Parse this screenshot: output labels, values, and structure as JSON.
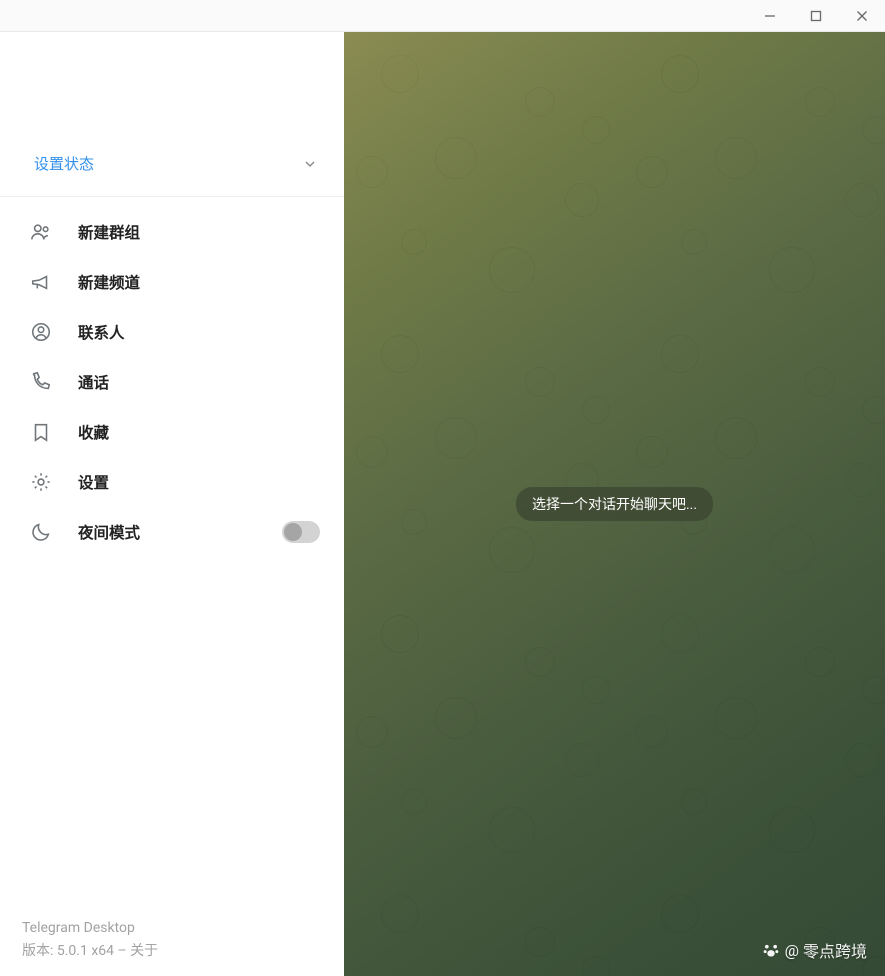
{
  "header": {
    "set_status": "设置状态"
  },
  "menu": {
    "new_group": "新建群组",
    "new_channel": "新建频道",
    "contacts": "联系人",
    "calls": "通话",
    "saved": "收藏",
    "settings": "设置",
    "night_mode": "夜间模式"
  },
  "chat": {
    "empty_hint": "选择一个对话开始聊天吧..."
  },
  "footer": {
    "app_name": "Telegram Desktop",
    "version_prefix": "版本: ",
    "version": "5.0.1 x64",
    "separator": " – ",
    "about": "关于"
  },
  "watermark": {
    "at": "@",
    "name": "零点跨境"
  }
}
